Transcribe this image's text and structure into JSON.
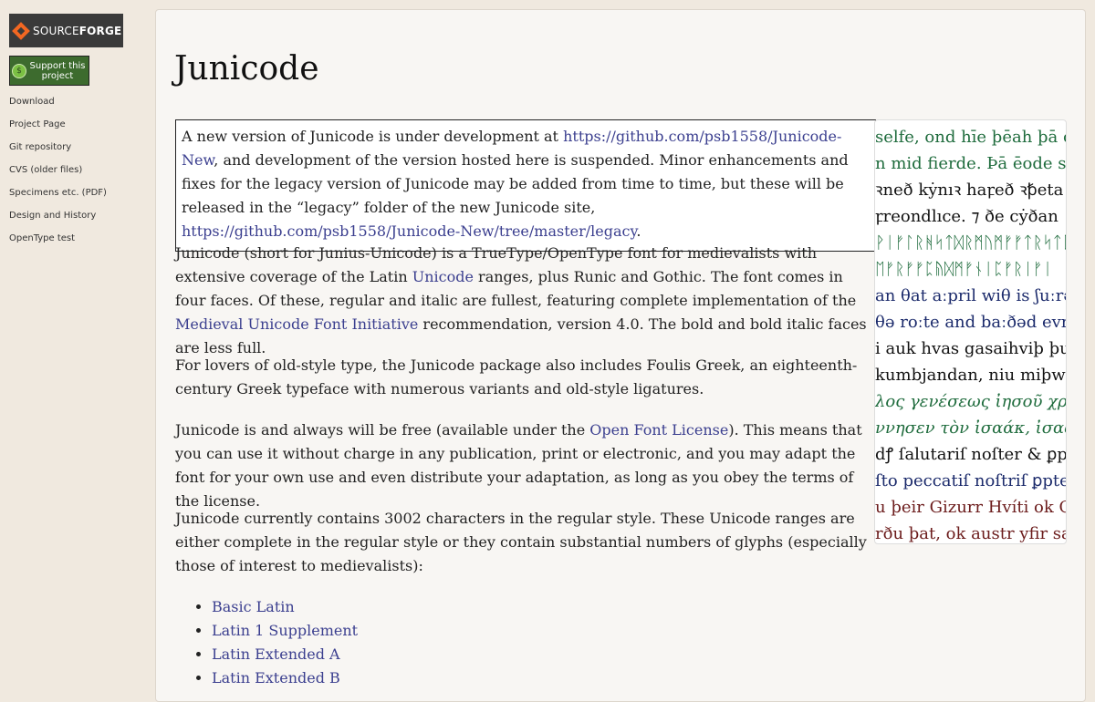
{
  "sidebar": {
    "logo": {
      "source": "SOURCE",
      "forge": "FORGE"
    },
    "support": {
      "line1": "Support this",
      "line2": "project",
      "icon_char": "$"
    },
    "nav": [
      "Download",
      "Project Page",
      "Git repository",
      "CVS (older files)",
      "Specimens etc. (PDF)",
      "Design and History",
      "OpenType test"
    ]
  },
  "main": {
    "title": "Junicode",
    "notice": {
      "t1": "A new version of Junicode is under development at ",
      "link1": "https://github.com/psb1558/Junicode-New",
      "t2": ", and development of the version hosted here is suspended. Minor enhancements and fixes for the legacy version of Junicode may be added from time to time, but these will be released in the “legacy” folder of the new Junicode site, ",
      "link2": "https://github.com/psb1558/Junicode-New/tree/master/legacy",
      "t3": "."
    },
    "p1": {
      "t1": "Junicode (short for Junius-Unicode) is a TrueType/OpenType font for medievalists with extensive coverage of the Latin ",
      "link1": "Unicode",
      "t2": " ranges, plus Runic and Gothic. The font comes in four faces. Of these, regular and italic are fullest, featuring complete implementation of the ",
      "link2": "Medieval Unicode Font Initiative",
      "t3": " recommendation, version 4.0. The bold and bold italic faces are less full."
    },
    "p2": "For lovers of old-style type, the Junicode package also includes Foulis Greek, an eighteenth-century Greek typeface with numerous variants and old-style ligatures.",
    "p3": {
      "t1": "Junicode is and always will be free (available under the ",
      "link1": "Open Font License",
      "t2": "). This means that you can use it without charge in any publication, print or electronic, and you may adapt the font for your own use and even distribute your adaptation, as long as you obey the terms of the license."
    },
    "p4": "Junicode currently contains 3002 characters in the regular style. These Unicode ranges are either complete in the regular style or they contain substantial numbers of glyphs (especially those of interest to medievalists):",
    "ranges": [
      "Basic Latin",
      "Latin 1 Supplement",
      "Latin Extended A",
      "Latin Extended B"
    ]
  },
  "specimen": [
    {
      "text": "selfe, ond hīe þēah þā ċe",
      "color": "green"
    },
    {
      "text": "n mid fierde. Þā ēode se",
      "color": "green"
    },
    {
      "text": "ꝛneð kẏnıꝛ haꝼeð ꝛꝥeta",
      "color": "black"
    },
    {
      "text": "ꝼreondlıce. ⁊ ðe cẏðan",
      "color": "black"
    },
    {
      "text": "ᚹᛁᚠᛚᚱᚻᛋᛏᛞᚱᛗᚢᛗᚠᚠᛏᚱᛋᛏᛈ",
      "color": "green"
    },
    {
      "text": "ᛖᚠᚱᚠᚠᛈᚥᛞᛗᚠᚾᛁᛈᚠᚱᛁᚠᛁ",
      "color": "green"
    },
    {
      "text": "an θat aːpril wiθ is ʃuːrə",
      "color": "navy"
    },
    {
      "text": "θə roːte and baːðəd evri",
      "color": "navy"
    },
    {
      "text": "i auk hvas gasaihviþ þuk",
      "color": "black"
    },
    {
      "text": "kumbjandan, niu miþwis",
      "color": "black"
    },
    {
      "text": "λος γενέσεως ἰησοῦ χριστο",
      "color": "green",
      "italic": true
    },
    {
      "text": "ννησεν τὸν ἰσαάκ, ἰσαὰκ δ",
      "color": "green",
      "italic": true
    },
    {
      "text": "dꝭ ſalutariſ noſter & ꝑp",
      "color": "black"
    },
    {
      "text": "ſto peccatiſ noſtriſ ꝑpter",
      "color": "navy"
    },
    {
      "text": "u þeir Gizurr Hvíti ok G",
      "color": "maroon"
    },
    {
      "text": "rðu þat, ok austr yfir san",
      "color": "maroon"
    }
  ]
}
